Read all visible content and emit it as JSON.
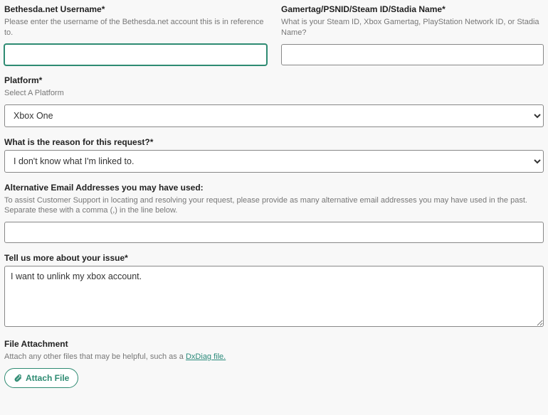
{
  "bethesda": {
    "label": "Bethesda.net Username*",
    "hint": "Please enter the username of the Bethesda.net account this is in reference to.",
    "value": ""
  },
  "gamertag": {
    "label": "Gamertag/PSNID/Steam ID/Stadia Name*",
    "hint": "What is your Steam ID, Xbox Gamertag, PlayStation Network ID, or Stadia Name?",
    "value": ""
  },
  "platform": {
    "label": "Platform*",
    "hint": "Select A Platform",
    "selected": "Xbox One",
    "options": [
      "Xbox One"
    ]
  },
  "reason": {
    "label": "What is the reason for this request?*",
    "selected": "I don't know what I'm linked to.",
    "options": [
      "I don't know what I'm linked to."
    ]
  },
  "altEmails": {
    "label": "Alternative Email Addresses you may have used:",
    "hint": "To assist Customer Support in locating and resolving your request, please provide as many alternative email addresses you may have used in the past. Separate these with a comma (,) in the line below.",
    "value": ""
  },
  "issue": {
    "label": "Tell us more about your issue*",
    "value": "I want to unlink my xbox account."
  },
  "attachment": {
    "label": "File Attachment",
    "hint_prefix": "Attach any other files that may be helpful, such as a ",
    "hint_link": "DxDiag file.",
    "button": "Attach File"
  }
}
